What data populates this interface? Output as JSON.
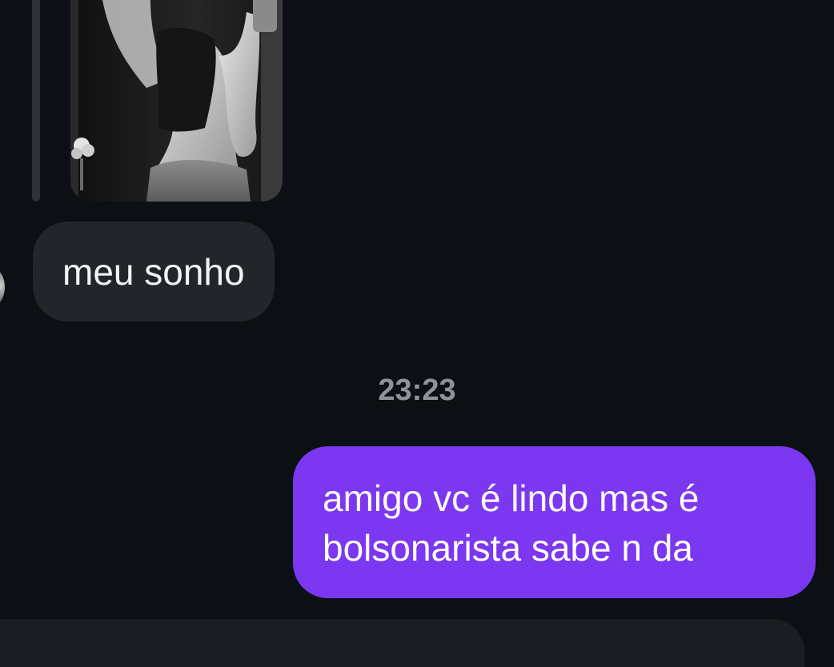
{
  "messages": {
    "incoming_text": "meu sonho",
    "timestamp": "23:23",
    "outgoing_line1": "amigo vc é lindo mas é",
    "outgoing_line2": "bolsonarista sabe n da"
  },
  "colors": {
    "background": "#0c0f13",
    "incoming_bubble": "#22262b",
    "outgoing_bubble": "#7c37f0",
    "timestamp_text": "#8d939c"
  }
}
